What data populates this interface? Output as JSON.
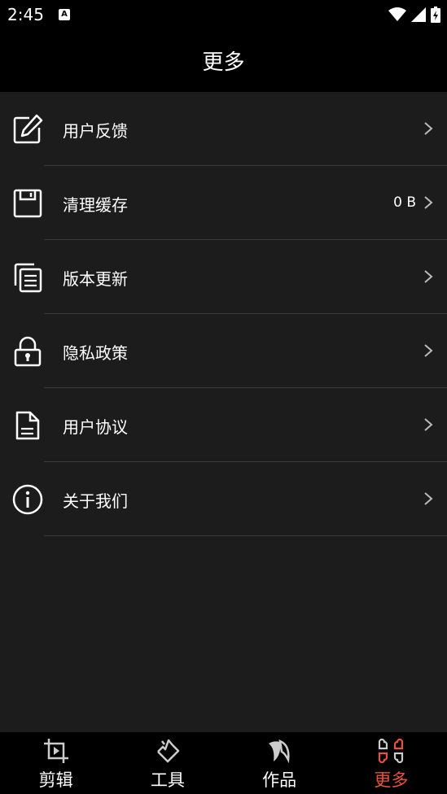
{
  "status_bar": {
    "time": "2:45",
    "notification_glyph": "A"
  },
  "header": {
    "title": "更多"
  },
  "menu": [
    {
      "label": "用户反馈",
      "value": "",
      "icon": "edit-icon"
    },
    {
      "label": "清理缓存",
      "value": "0 B",
      "icon": "save-disk-icon"
    },
    {
      "label": "版本更新",
      "value": "",
      "icon": "copy-documents-icon"
    },
    {
      "label": "隐私政策",
      "value": "",
      "icon": "lock-icon"
    },
    {
      "label": "用户协议",
      "value": "",
      "icon": "document-icon"
    },
    {
      "label": "关于我们",
      "value": "",
      "icon": "info-icon"
    }
  ],
  "nav": [
    {
      "label": "剪辑",
      "icon": "crop-play-icon",
      "active": false
    },
    {
      "label": "工具",
      "icon": "tools-icon",
      "active": false
    },
    {
      "label": "作品",
      "icon": "works-icon",
      "active": false
    },
    {
      "label": "更多",
      "icon": "more-grid-icon",
      "active": true
    }
  ],
  "colors": {
    "accent": "#e8533d",
    "background": "#1c1c1c",
    "bar": "#000000"
  }
}
